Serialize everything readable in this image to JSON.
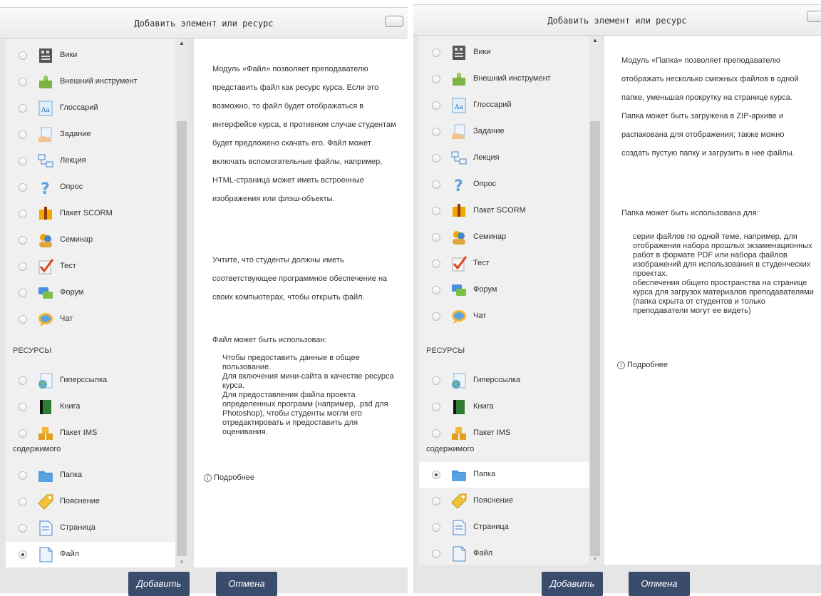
{
  "left_dialog": {
    "title": "Добавить элемент или ресурс",
    "activities": [
      {
        "label": "Вики",
        "icon": "wiki-icon",
        "selected": false
      },
      {
        "label": "Внешний инструмент",
        "icon": "puzzle-icon",
        "selected": false
      },
      {
        "label": "Глоссарий",
        "icon": "glossary-icon",
        "selected": false
      },
      {
        "label": "Задание",
        "icon": "assignment-hand-icon",
        "selected": false
      },
      {
        "label": "Лекция",
        "icon": "lesson-icon",
        "selected": false
      },
      {
        "label": "Опрос",
        "icon": "question-icon",
        "selected": false
      },
      {
        "label": "Пакет SCORM",
        "icon": "scorm-icon",
        "selected": false
      },
      {
        "label": "Семинар",
        "icon": "workshop-icon",
        "selected": false
      },
      {
        "label": "Тест",
        "icon": "quiz-check-icon",
        "selected": false
      },
      {
        "label": "Форум",
        "icon": "forum-icon",
        "selected": false
      },
      {
        "label": "Чат",
        "icon": "chat-icon",
        "selected": false
      }
    ],
    "resources_heading": "РЕСУРСЫ",
    "resources": [
      {
        "label": "Гиперссылка",
        "icon": "url-icon",
        "selected": false
      },
      {
        "label": "Книга",
        "icon": "book-icon",
        "selected": false
      },
      {
        "label": "Пакет IMS",
        "icon": "ims-icon",
        "selected": false
      },
      {
        "label": "Папка",
        "icon": "folder-icon",
        "selected": false
      },
      {
        "label": "Пояснение",
        "icon": "label-tag-icon",
        "selected": false
      },
      {
        "label": "Страница",
        "icon": "page-icon",
        "selected": false
      },
      {
        "label": "Файл",
        "icon": "file-icon",
        "selected": true
      }
    ],
    "ims_wrap": "содержимого",
    "description": {
      "para1": "Модуль «Файл» позволяет преподавателю представить файл как ресурс курса. Если это возможно, то файл будет отображаться в интерфейсе курса, в противном случае студентам будет предложено скачать его. Файл может включать вспомогательные файлы, например, HTML-страница может иметь встроенные изображения или флэш-объекты.",
      "para2": "Учтите, что студенты должны иметь соответствующее программное обеспечение на своих компьютерах, чтобы открыть файл.",
      "para3": "Файл может быть использован:",
      "list": "Чтобы предоставить данные в общее пользование.\nДля включения мини-сайта в качестве ресурса курса.\nДля предоставления файла проекта определенных программ (например, .psd для Photoshop), чтобы студенты могли его отредактировать и предоставить для оценивания.",
      "more": "Подробнее"
    },
    "add_button": "Добавить",
    "cancel_button": "Отмена"
  },
  "right_dialog": {
    "title": "Добавить элемент или ресурс",
    "activities": [
      {
        "label": "Вики"
      },
      {
        "label": "Внешний инструмент"
      },
      {
        "label": "Глоссарий"
      },
      {
        "label": "Задание"
      },
      {
        "label": "Лекция"
      },
      {
        "label": "Опрос"
      },
      {
        "label": "Пакет SCORM"
      },
      {
        "label": "Семинар"
      },
      {
        "label": "Тест"
      },
      {
        "label": "Форум"
      },
      {
        "label": "Чат"
      }
    ],
    "resources_heading": "РЕСУРСЫ",
    "resources": [
      {
        "label": "Гиперссылка",
        "selected": false
      },
      {
        "label": "Книга",
        "selected": false
      },
      {
        "label": "Пакет IMS",
        "selected": false
      },
      {
        "label": "Папка",
        "selected": true
      },
      {
        "label": "Пояснение",
        "selected": false
      },
      {
        "label": "Страница",
        "selected": false
      },
      {
        "label": "Файл",
        "selected": false
      }
    ],
    "ims_wrap": "содержимого",
    "description": {
      "para1": "Модуль «Папка» позволяет преподавателю отображать несколько смежных файлов в одной папке, уменьшая прокрутку на странице курса. Папка может быть загружена в ZIP-архиве и распакована для отображения; также можно создать пустую папку и загрузить в нее файлы.",
      "para2": "Папка может быть использована для:",
      "list": "серии файлов по одной теме, например, для отображения набора прошлых экзаменационных работ в формате PDF или набора файлов изображений для использования в студенческих проектах.\nобеспечения общего пространства на странице курса для загрузок материалов преподавателями (папка скрыта от студентов и только преподаватели могут ее видеть)",
      "more": "Подробнее"
    },
    "add_button": "Добавить",
    "cancel_button": "Отмена"
  },
  "colors": {
    "button_bg": "#3a4c6c",
    "list_bg": "#f0f0f0",
    "dialog_bg": "#e6e6e6"
  }
}
